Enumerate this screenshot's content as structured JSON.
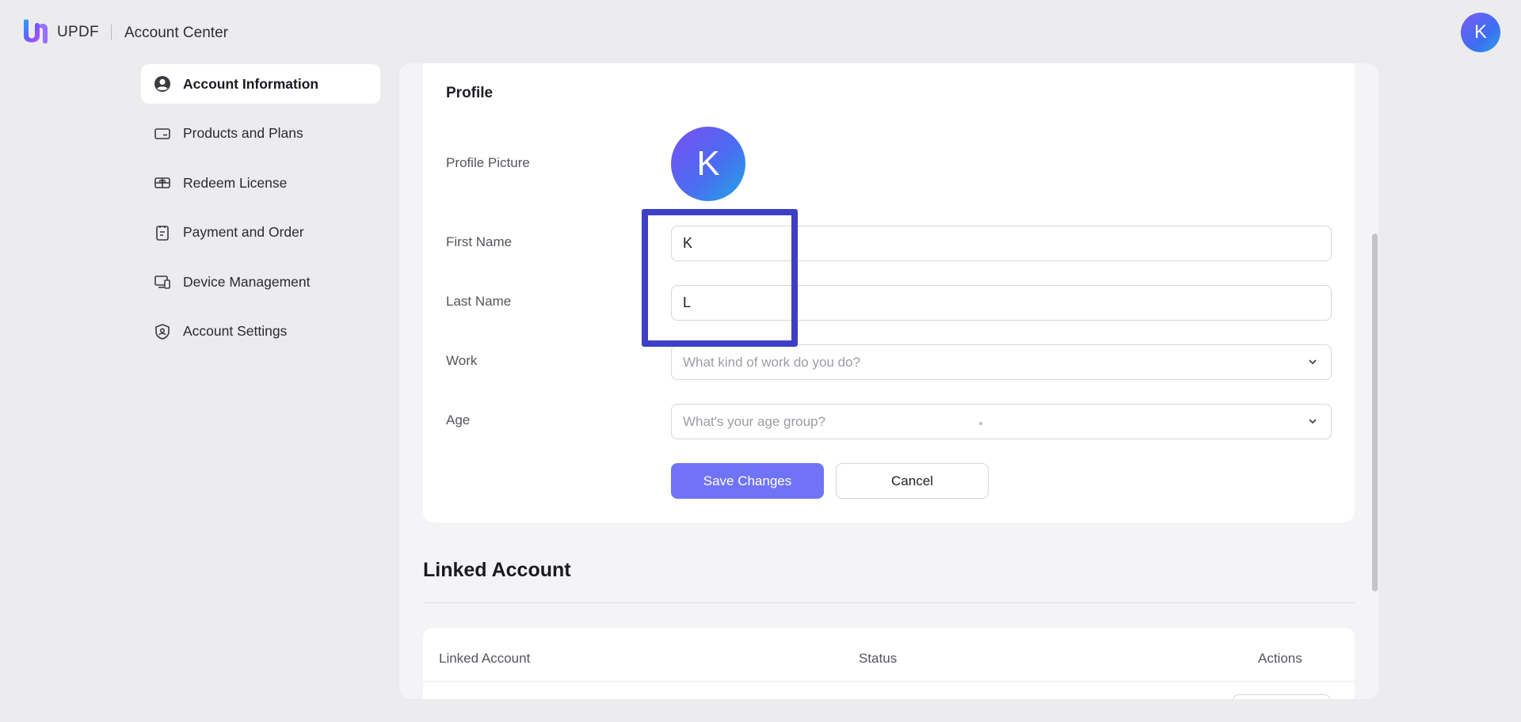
{
  "header": {
    "brand": "UPDF",
    "title": "Account Center",
    "avatar_letter": "K"
  },
  "sidebar": {
    "items": [
      {
        "label": "Account Information",
        "icon": "user-circle-icon",
        "active": true
      },
      {
        "label": "Products and Plans",
        "icon": "card-icon",
        "active": false
      },
      {
        "label": "Redeem License",
        "icon": "gift-card-icon",
        "active": false
      },
      {
        "label": "Payment and Order",
        "icon": "clipboard-icon",
        "active": false
      },
      {
        "label": "Device Management",
        "icon": "devices-icon",
        "active": false
      },
      {
        "label": "Account Settings",
        "icon": "shield-user-icon",
        "active": false
      }
    ]
  },
  "profile": {
    "title": "Profile",
    "picture_label": "Profile Picture",
    "picture_letter": "K",
    "first_name_label": "First Name",
    "first_name_value": "K",
    "last_name_label": "Last Name",
    "last_name_value": "L",
    "work_label": "Work",
    "work_placeholder": "What kind of work do you do?",
    "age_label": "Age",
    "age_placeholder": "What's your age group?",
    "save_label": "Save Changes",
    "cancel_label": "Cancel"
  },
  "linked": {
    "title": "Linked Account",
    "columns": [
      "Linked Account",
      "Status",
      "Actions"
    ]
  },
  "colors": {
    "accent": "#7173f7",
    "highlight": "#3d3fc6",
    "background": "#ececee"
  }
}
